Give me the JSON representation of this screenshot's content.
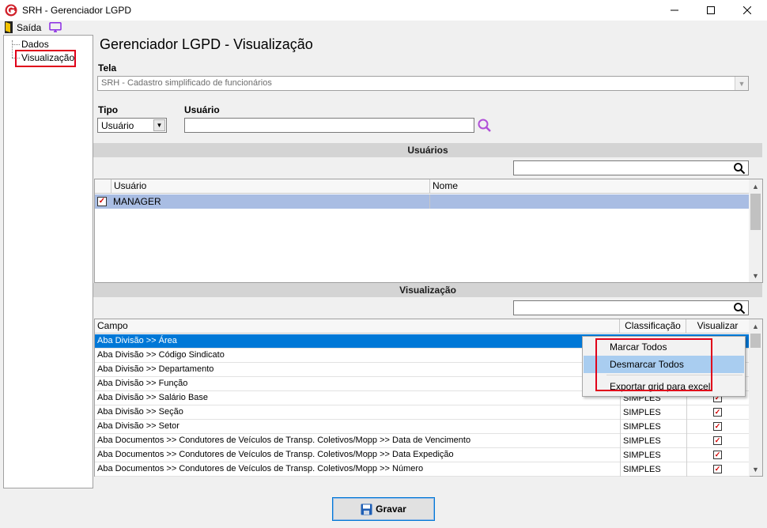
{
  "window": {
    "title": "SRH - Gerenciador LGPD",
    "controls": {
      "minimize": "—",
      "maximize": "☐",
      "close": "✕"
    }
  },
  "toolbar": {
    "saida_label": "Saída",
    "saida_icon": "exit-door-icon",
    "screen_icon": "monitor-icon"
  },
  "tree": {
    "items": [
      {
        "label": "Dados"
      },
      {
        "label": "Visualização"
      }
    ]
  },
  "page": {
    "title": "Gerenciador LGPD - Visualização"
  },
  "tela": {
    "label": "Tela",
    "value": "SRH - Cadastro simplificado de funcionários"
  },
  "tipo": {
    "label": "Tipo",
    "value": "Usuário"
  },
  "usuario": {
    "label": "Usuário",
    "value": ""
  },
  "usuarios_section": {
    "title": "Usuários",
    "filter_value": "",
    "columns": [
      "Usuário",
      "Nome"
    ],
    "rows": [
      {
        "checked": true,
        "usuario": "MANAGER",
        "nome": ""
      }
    ]
  },
  "visualizacao_section": {
    "title": "Visualização",
    "filter_value": "",
    "columns": [
      "Campo",
      "Classificação",
      "Visualizar"
    ],
    "rows": [
      {
        "campo": "Aba Divisão >> Área",
        "classificacao": "",
        "visualizar": true
      },
      {
        "campo": "Aba Divisão >> Código Sindicato",
        "classificacao": "",
        "visualizar": true
      },
      {
        "campo": "Aba Divisão >> Departamento",
        "classificacao": "",
        "visualizar": true
      },
      {
        "campo": "Aba Divisão >> Função",
        "classificacao": "",
        "visualizar": true
      },
      {
        "campo": "Aba Divisão >> Salário Base",
        "classificacao": "SIMPLES",
        "visualizar": true
      },
      {
        "campo": "Aba Divisão >> Seção",
        "classificacao": "SIMPLES",
        "visualizar": true
      },
      {
        "campo": "Aba Divisão >> Setor",
        "classificacao": "SIMPLES",
        "visualizar": true
      },
      {
        "campo": "Aba Documentos >>  Condutores de Veículos de Transp. Coletivos/Mopp >> Data de Vencimento",
        "classificacao": "SIMPLES",
        "visualizar": true
      },
      {
        "campo": "Aba Documentos >>  Condutores de Veículos de Transp. Coletivos/Mopp >> Data Expedição",
        "classificacao": "SIMPLES",
        "visualizar": true
      },
      {
        "campo": "Aba Documentos >>  Condutores de Veículos de Transp. Coletivos/Mopp >> Número",
        "classificacao": "SIMPLES",
        "visualizar": true
      }
    ]
  },
  "context_menu": {
    "items": [
      "Marcar Todos",
      "Desmarcar Todos",
      "Exportar grid para excel"
    ],
    "hovered_index": 1
  },
  "save_button": {
    "label": "Gravar",
    "icon": "floppy-disk-icon"
  },
  "colors": {
    "selection": "#0078d7",
    "highlight_box": "#e0001a",
    "user_row": "#a9bde3"
  }
}
